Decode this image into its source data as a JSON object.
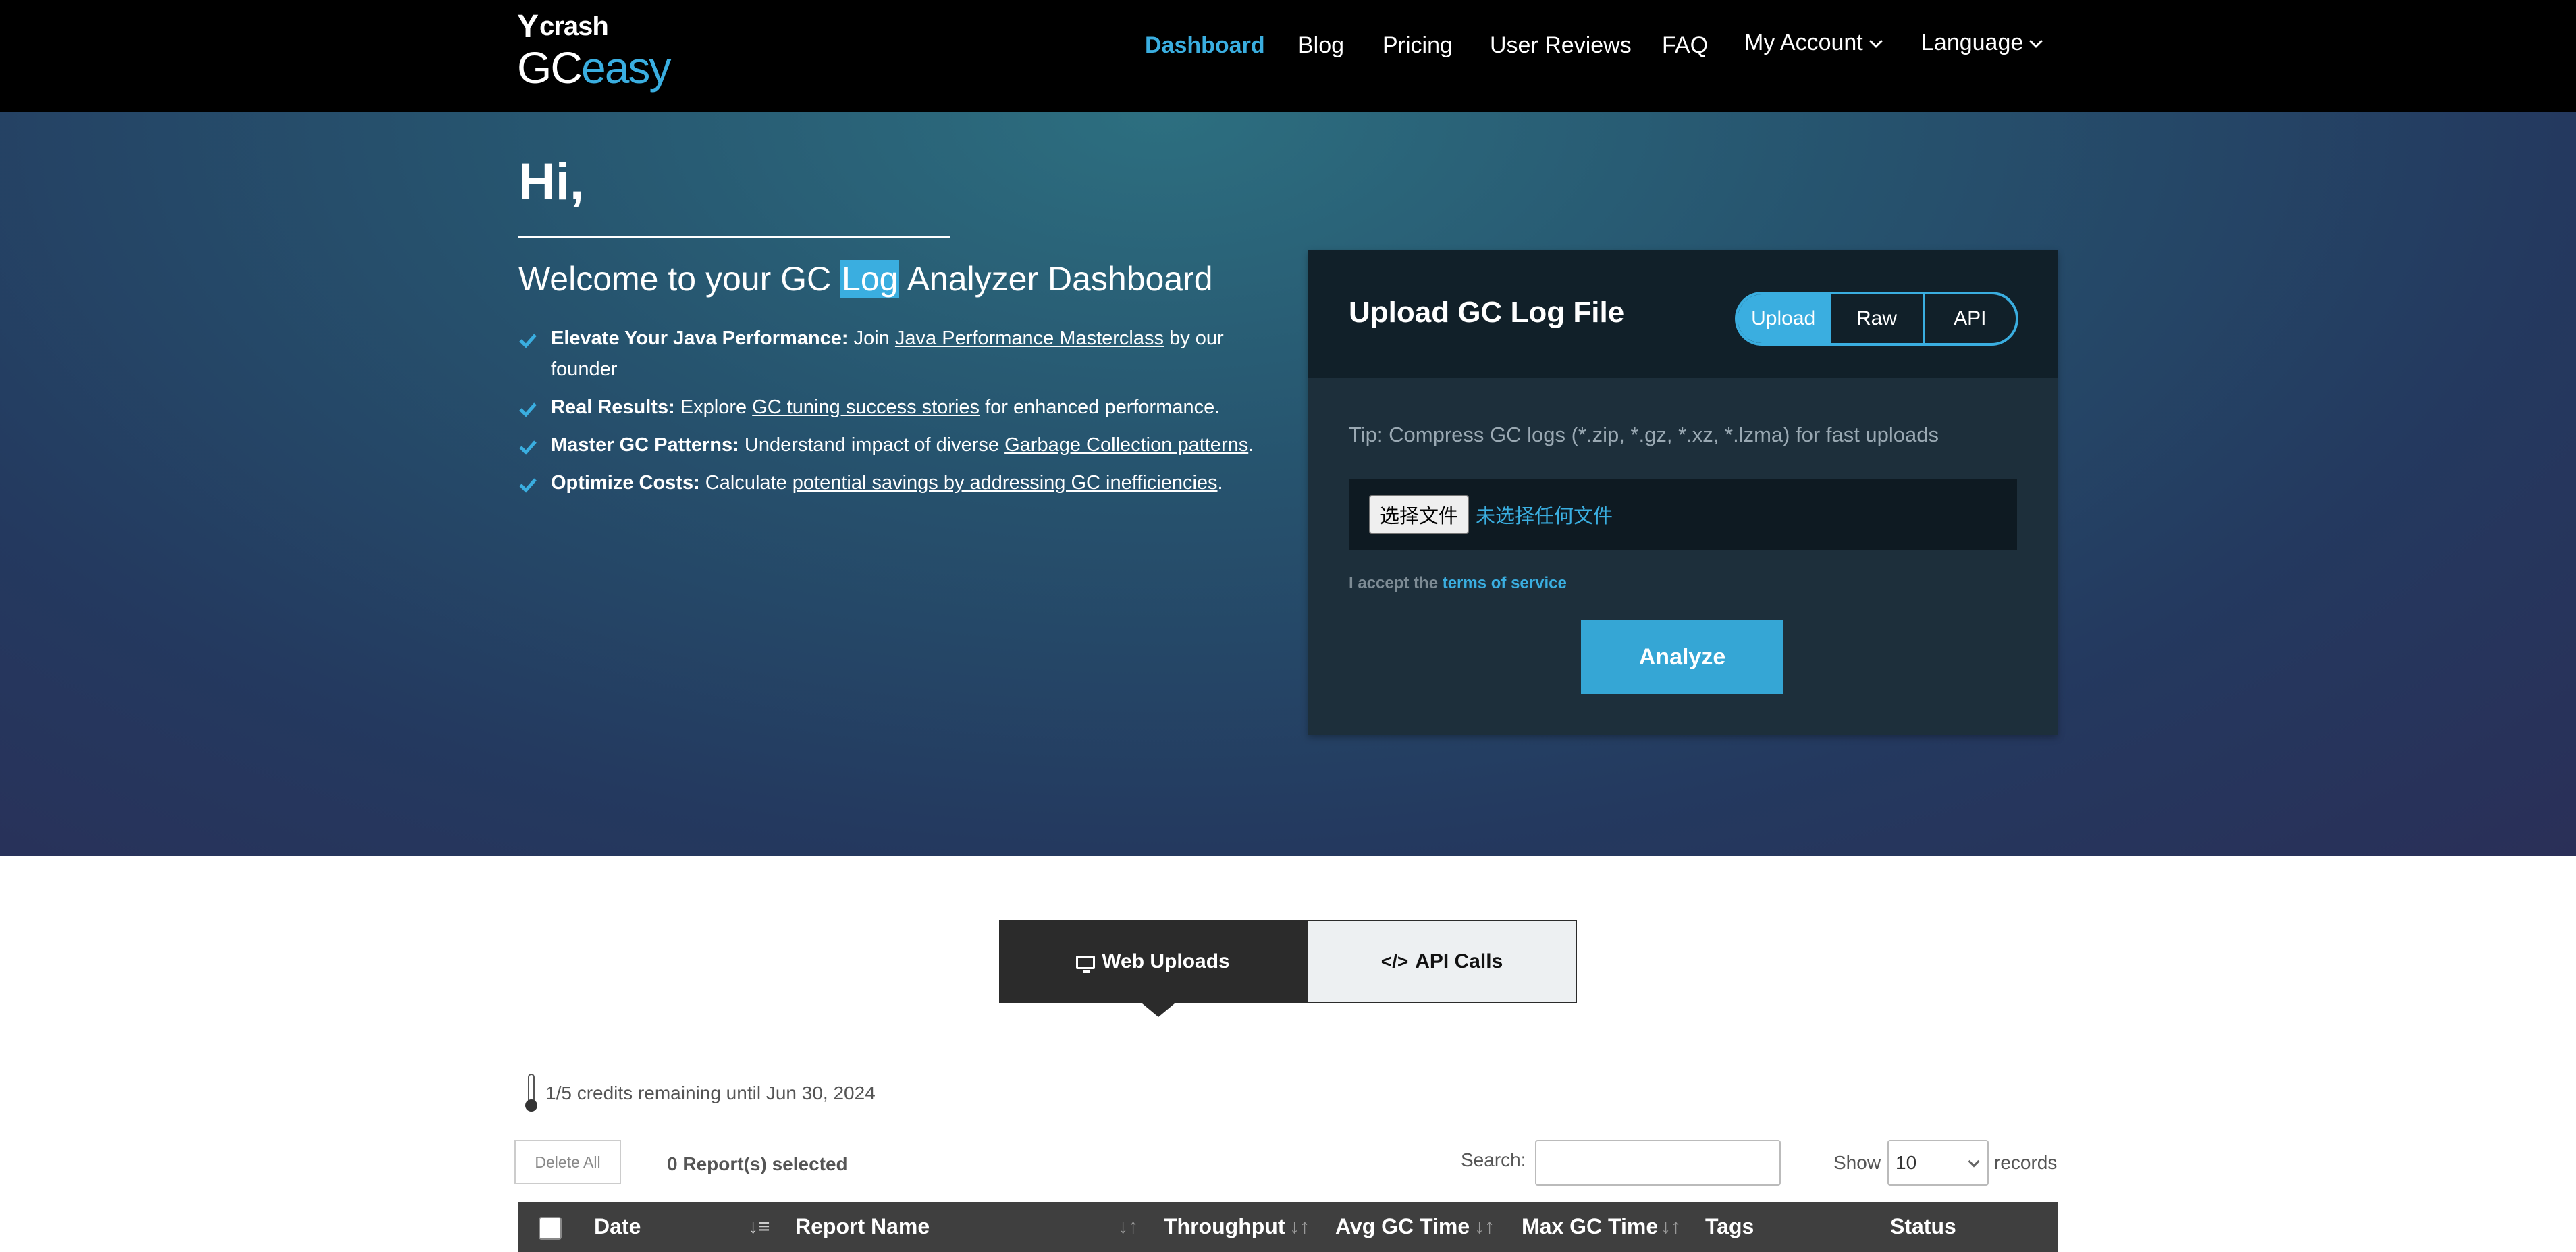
{
  "brand": {
    "top": "crash",
    "gc": "GC",
    "easy": "easy"
  },
  "nav": {
    "items": [
      {
        "label": "Dashboard"
      },
      {
        "label": "Blog"
      },
      {
        "label": "Pricing"
      },
      {
        "label": "User Reviews"
      },
      {
        "label": "FAQ"
      },
      {
        "label": "My Account"
      },
      {
        "label": "Language"
      }
    ]
  },
  "hero": {
    "greeting": "Hi,",
    "welcome_before": "Welcome to your GC ",
    "welcome_highlight": "Log",
    "welcome_after": " Analyzer Dashboard",
    "bullets": [
      {
        "bold": "Elevate Your Java Performance:",
        "pre": " Join ",
        "link": "Java Performance Masterclass",
        "post": " by our founder"
      },
      {
        "bold": "Real Results:",
        "pre": " Explore ",
        "link": "GC tuning success stories",
        "post": " for enhanced performance."
      },
      {
        "bold": "Master GC Patterns:",
        "pre": " Understand impact of diverse ",
        "link": "Garbage Collection patterns",
        "post": "."
      },
      {
        "bold": "Optimize Costs:",
        "pre": " Calculate ",
        "link": "potential savings by addressing GC inefficiencies",
        "post": "."
      }
    ]
  },
  "upload": {
    "title": "Upload GC Log File",
    "modes": [
      "Upload",
      "Raw",
      "API"
    ],
    "tip": "Tip: Compress GC logs (*.zip, *.gz, *.xz, *.lzma) for fast uploads",
    "file_button": "选择文件",
    "file_status": "未选择任何文件",
    "accept_prefix": "I accept the ",
    "accept_link": "terms of service",
    "analyze": "Analyze"
  },
  "tabs": {
    "web_uploads": "Web Uploads",
    "api_calls": "API Calls"
  },
  "credits": "1/5 credits remaining until Jun 30, 2024",
  "table": {
    "delete_all": "Delete All",
    "selected": "0 Report(s) selected",
    "search_label": "Search:",
    "search_value": "",
    "show_label": "Show",
    "show_value": "10",
    "records_label": "records",
    "columns": [
      "Date",
      "Report Name",
      "Throughput",
      "Avg GC Time",
      "Max GC Time",
      "Tags",
      "Status"
    ]
  },
  "colors": {
    "accent": "#3aaee0",
    "nav_bg": "#000000",
    "panel": "#1d2f3b",
    "table_header": "#3f3f3f"
  }
}
